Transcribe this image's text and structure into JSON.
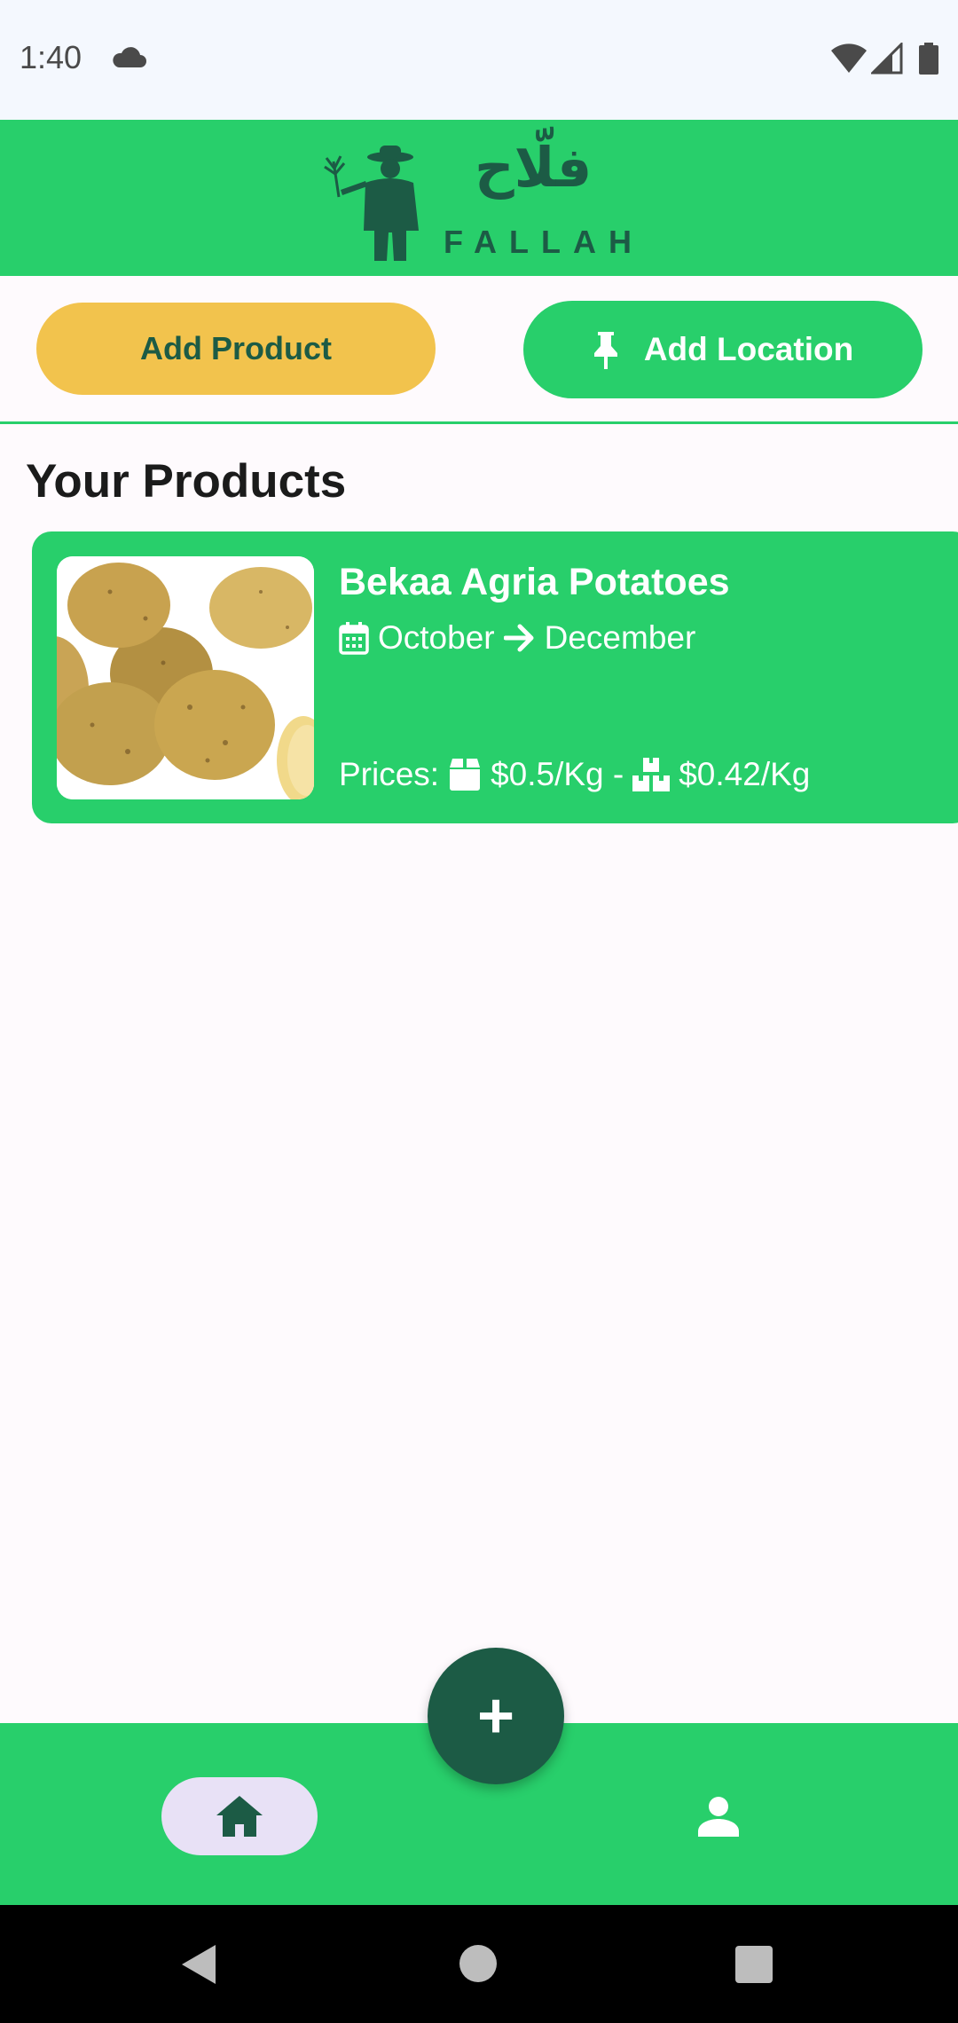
{
  "status_bar": {
    "time": "1:40"
  },
  "header": {
    "logo_arabic": "فلّاح",
    "logo_text": "FALLAH"
  },
  "actions": {
    "add_product_label": "Add Product",
    "add_location_label": "Add Location"
  },
  "section_title": "Your Products",
  "products": [
    {
      "name": "Bekaa Agria Potatoes",
      "season_start": "October",
      "season_end": "December",
      "prices_label": "Prices:",
      "single_price": "$0.5/Kg -",
      "bulk_price": "$0.42/Kg"
    }
  ],
  "fab": {
    "label": "+"
  },
  "colors": {
    "primary_green": "#28cf6b",
    "dark_green": "#1c5b45",
    "accent_yellow": "#f2c34d",
    "nav_pill": "#e8e1f6"
  },
  "icons": [
    "cloud-icon",
    "wifi-icon",
    "signal-icon",
    "battery-icon",
    "pin-icon",
    "calendar-icon",
    "arrow-right-icon",
    "box-icon",
    "boxes-icon",
    "home-icon",
    "person-icon"
  ]
}
